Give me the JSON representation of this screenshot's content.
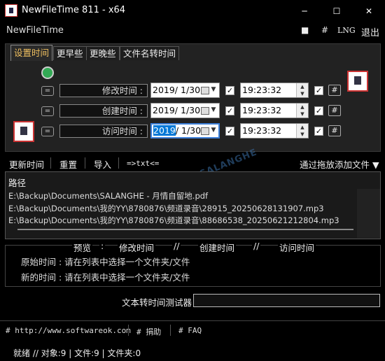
{
  "window": {
    "title": "NewFileTime 811 - x64",
    "minimize_glyph": "─",
    "maximize_glyph": "☐",
    "close_glyph": "✕"
  },
  "menu": {
    "app_name": "NewFileTime",
    "square_glyph": "■",
    "hash": "#",
    "lng": "LNG",
    "exit": "退出"
  },
  "tabs": [
    "设置时间",
    "更早些",
    "更晚些",
    "文件名转时间"
  ],
  "time_rows": [
    {
      "label": "修改时间 :",
      "date": "2019/  1/30",
      "time": "19:23:32"
    },
    {
      "label": "创建时间 :",
      "date": "2019/  1/30",
      "time": "19:23:32"
    },
    {
      "label": "访问时间 :",
      "date_selected": "2019",
      "date_rest": "/  1/30",
      "time": "19:23:32"
    }
  ],
  "controls": {
    "equals": "=",
    "hash": "#",
    "check": "✓",
    "spin_up": "▲",
    "spin_down": "▼",
    "dropdown": "▼",
    "now_icon": "◉"
  },
  "toolbar": {
    "update": "更新时间",
    "reset": "重置",
    "import": "导入",
    "txt": "=>txt<=",
    "drag_drop": "通过拖放添加文件 ▼"
  },
  "watermark": "SALANGHE",
  "file_list": {
    "header": "路径",
    "rows": [
      "E:\\Backup\\Documents\\SALANGHE - 月情自留地.pdf",
      "E:\\Backup\\Documents\\我的YY\\8780876\\频道录音\\28915_20250628131907.mp3",
      "E:\\Backup\\Documents\\我的YY\\8780876\\频道录音\\88686538_20250621212804.mp3"
    ]
  },
  "preview": {
    "h_preview": "预览",
    "colon": ":",
    "h_modified": "修改时间",
    "slashes": "//",
    "h_created": "创建时间",
    "h_accessed": "访问时间",
    "original": "原始时间 : 请在列表中选择一个文件夹/文件",
    "new": "新的时间 : 请在列表中选择一个文件夹/文件"
  },
  "tester": {
    "label": "文本转时间测试器",
    "value": ""
  },
  "footer": {
    "website": "# http://www.softwareok.com",
    "donate": "# 捐助",
    "faq": "# FAQ"
  },
  "status": {
    "text": "就绪 // 对象:9  | 文件:9   | 文件夹:0"
  }
}
